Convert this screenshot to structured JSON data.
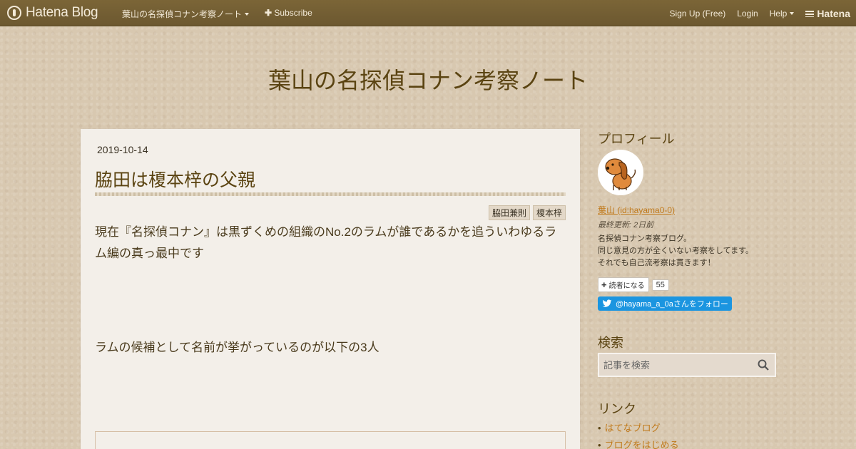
{
  "topbar": {
    "logo_text": "Hatena Blog",
    "blog_menu": "葉山の名探偵コナン考察ノート",
    "subscribe": "Subscribe",
    "signup": "Sign Up (Free)",
    "login": "Login",
    "help": "Help",
    "hatena": "Hatena"
  },
  "blog": {
    "title": "葉山の名探偵コナン考察ノート"
  },
  "entry": {
    "date": "2019-10-14",
    "title": "脇田は榎本梓の父親",
    "tags": [
      "脇田兼則",
      "榎本梓"
    ],
    "paragraphs": [
      "現在『名探偵コナン』は黒ずくめの組織のNo.2のラムが誰であるかを追ういわゆるラム編の真っ最中です",
      "ラムの候補として名前が挙がっているのが以下の3人"
    ]
  },
  "sidebar": {
    "profile_heading": "プロフィール",
    "profile_name": "葉山 (id:hayama0-0)",
    "updated": "最終更新: 2日前",
    "description": [
      "名探偵コナン考察ブログ。",
      "同じ意見の方が全くいない考察をしてます。",
      "それでも自己流考察は貫きます！"
    ],
    "reader_label": "読者になる",
    "reader_count": "55",
    "twitter_follow": "@hayama_a_0aさんをフォロー",
    "search_heading": "検索",
    "search_placeholder": "記事を検索",
    "links_heading": "リンク",
    "links": [
      "はてなブログ",
      "ブログをはじめる"
    ]
  },
  "colors": {
    "topbar": "#6f5a31",
    "title": "#5b4412",
    "link": "#c0791a",
    "twitter": "#1b95e0"
  }
}
